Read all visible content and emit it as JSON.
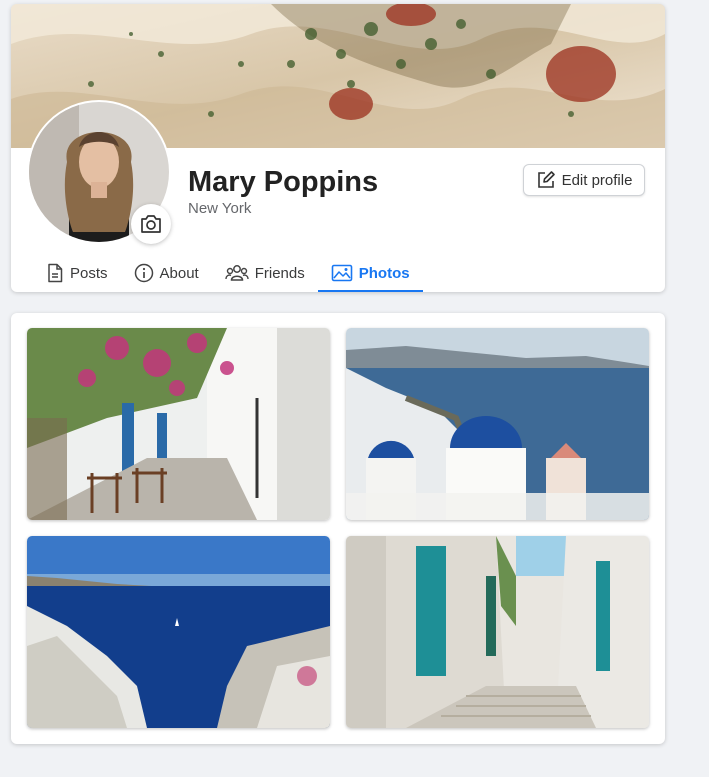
{
  "profile": {
    "name": "Mary Poppins",
    "location": "New York",
    "edit_label": "Edit profile"
  },
  "tabs": [
    {
      "label": "Posts",
      "icon": "document-icon"
    },
    {
      "label": "About",
      "icon": "info-icon"
    },
    {
      "label": "Friends",
      "icon": "friends-icon"
    },
    {
      "label": "Photos",
      "icon": "image-icon",
      "active": true
    }
  ],
  "colors": {
    "accent": "#1877f2",
    "background": "#f0f2f5",
    "card": "#ffffff",
    "muted_text": "#65676b"
  },
  "photos": [
    {
      "subject": "whitewashed alley with bougainvillea and cafe chairs"
    },
    {
      "subject": "blue domed church over the caldera sea"
    },
    {
      "subject": "deep blue bay seen over white clifftop houses"
    },
    {
      "subject": "narrow stepped lane with turquoise doors"
    }
  ]
}
